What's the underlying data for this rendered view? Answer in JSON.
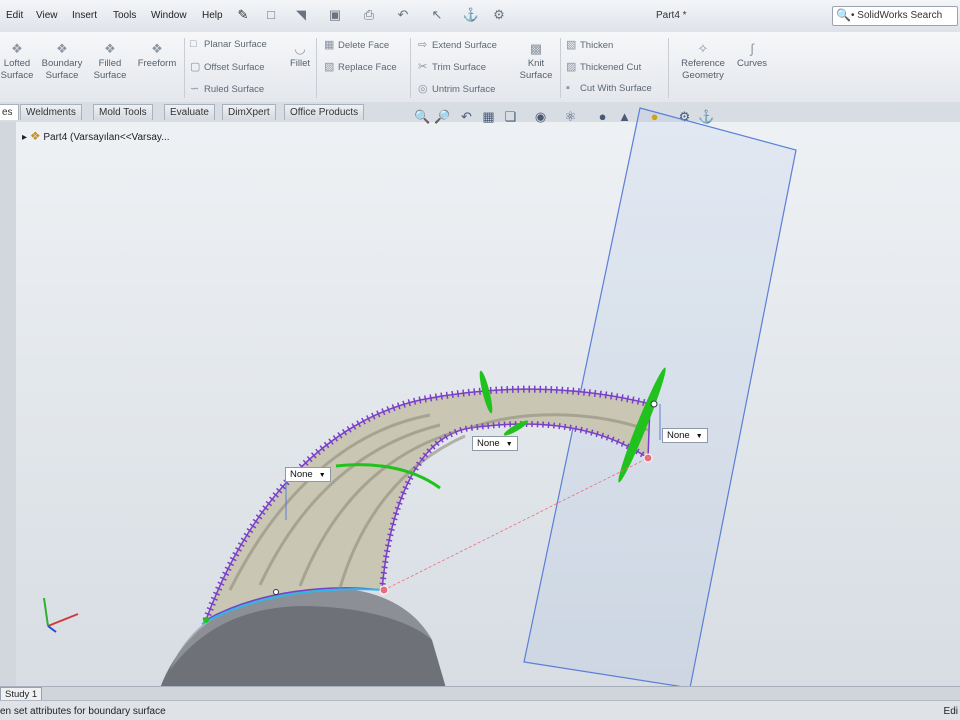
{
  "menu": {
    "items": [
      "Edit",
      "View",
      "Insert",
      "Tools",
      "Window",
      "Help"
    ],
    "doc_title": "Part4 *",
    "search_placeholder": "SolidWorks Search"
  },
  "ribbon": {
    "large_left": [
      {
        "label_1": "Lofted",
        "label_2": "Surface",
        "icon": "lofted-surface-icon"
      },
      {
        "label_1": "Boundary",
        "label_2": "Surface",
        "icon": "boundary-surface-icon"
      },
      {
        "label_1": "Filled",
        "label_2": "Surface",
        "icon": "filled-surface-icon"
      },
      {
        "label_1": "Freeform",
        "label_2": "",
        "icon": "freeform-icon"
      }
    ],
    "group_a": [
      "Planar Surface",
      "Offset Surface",
      "Ruled Surface"
    ],
    "fillet": "Fillet",
    "group_b": [
      "Delete Face",
      "Replace Face"
    ],
    "group_c": [
      "Extend Surface",
      "Trim Surface",
      "Untrim Surface"
    ],
    "knit_1": "Knit",
    "knit_2": "Surface",
    "group_d": [
      "Thicken",
      "Thickened Cut",
      "Cut With Surface"
    ],
    "ref_geometry_1": "Reference",
    "ref_geometry_2": "Geometry",
    "curves": "Curves"
  },
  "tabs": [
    "Weldments",
    "Mold Tools",
    "Evaluate",
    "DimXpert",
    "Office Products"
  ],
  "tab_stub": "es",
  "tree": {
    "label": "Part4 (Varsayılan<<Varsay..."
  },
  "callouts": [
    "None",
    "None",
    "None"
  ],
  "bottom_tab": "Study 1",
  "status": {
    "text": "en set attributes for boundary surface",
    "right": "Edi"
  },
  "colors": {
    "preview_purple": "#7a3fc8",
    "plane_blue": "#5b7fd6",
    "handle_green": "#22c21e",
    "surface_body": "#6f7178"
  }
}
